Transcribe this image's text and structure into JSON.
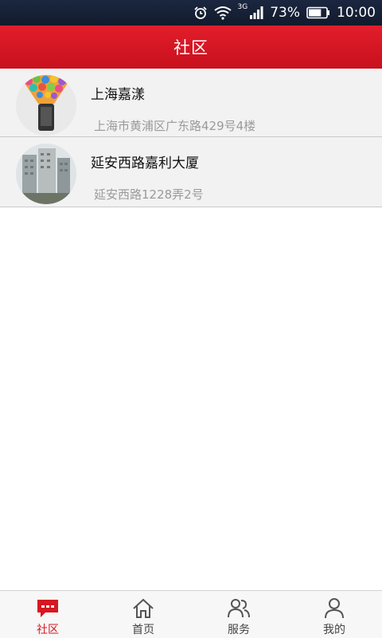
{
  "status_bar": {
    "network": "3G",
    "battery": "73%",
    "time": "10:00",
    "battery_level": 0.73
  },
  "header": {
    "title": "社区"
  },
  "communities": [
    {
      "name": "上海嘉漾",
      "address": "上海市黄浦区广东路429号4楼"
    },
    {
      "name": "延安西路嘉利大厦",
      "address": "延安西路1228弄2号"
    }
  ],
  "tabs": [
    {
      "label": "社区",
      "icon": "chat-bubble-icon",
      "active": true
    },
    {
      "label": "首页",
      "icon": "home-icon",
      "active": false
    },
    {
      "label": "服务",
      "icon": "people-icon",
      "active": false
    },
    {
      "label": "我的",
      "icon": "person-icon",
      "active": false
    }
  ],
  "colors": {
    "header_red": "#d6161f",
    "active_tab": "#d61822",
    "list_background": "#f2f2f2"
  }
}
